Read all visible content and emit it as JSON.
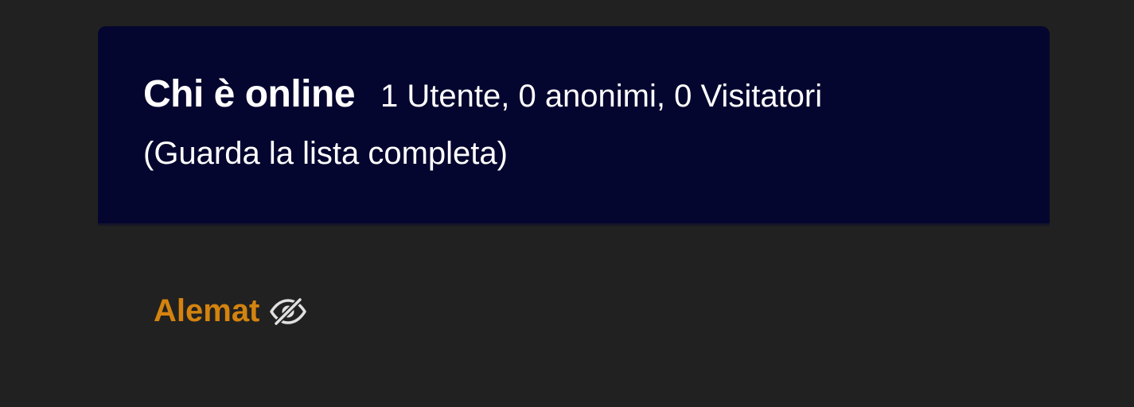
{
  "online_widget": {
    "title": "Chi è online",
    "stats": "1 Utente, 0 anonimi, 0 Visitatori",
    "full_list_link": "(Guarda la lista completa)",
    "users": [
      {
        "name": "Alemat",
        "status_icon": "eye-slash-icon",
        "color": "#d4830f"
      }
    ]
  },
  "colors": {
    "page_background": "#212121",
    "header_background": "#05062f",
    "text": "#ffffff",
    "username": "#d4830f",
    "icon": "#e0e0e0"
  }
}
